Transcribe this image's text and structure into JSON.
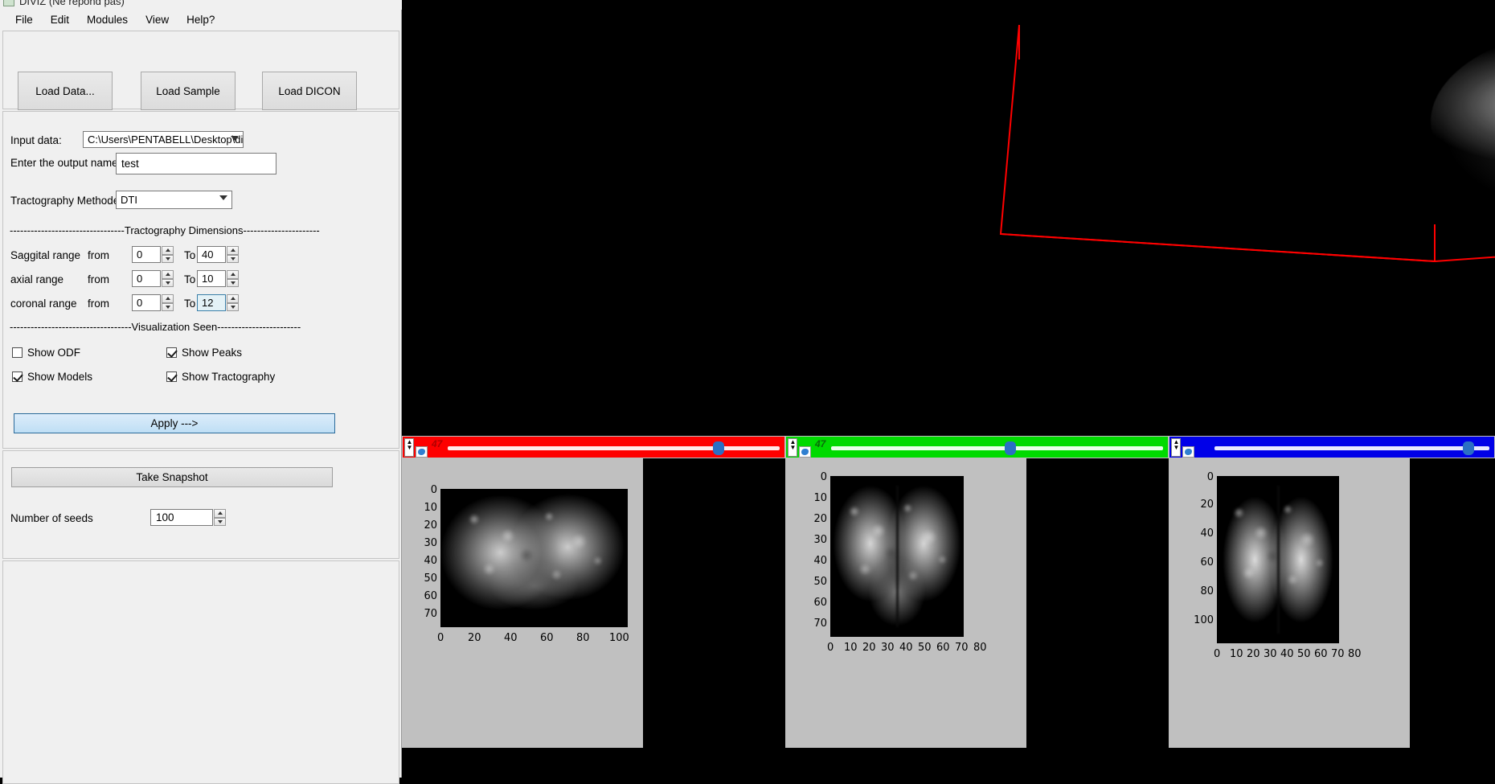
{
  "window": {
    "title": "DIVIZ (Ne repond pas)",
    "app_icon": "app-icon"
  },
  "menu": {
    "items": [
      "File",
      "Edit",
      "Modules",
      "View",
      "Help?"
    ]
  },
  "toolbar": {
    "load_data_label": "Load Data...",
    "load_sample_data_label": "Load Sample Data...",
    "load_dicom_data_label": "Load DICON Data..."
  },
  "form": {
    "input_data_label": "Input data:",
    "input_data_value": "C:\\Users\\PENTABELL\\Desktop\\dipy_",
    "output_name_label": "Enter the output name",
    "output_name_value": "test",
    "output_name_placeholder": "",
    "tractography_method_label": "Tractography Methode:",
    "tractography_method_value": "DTI"
  },
  "dimensions": {
    "section_title": "Tractography Dimensions",
    "from_label": "from",
    "to_label": "To",
    "rows": [
      {
        "label": "Saggital range",
        "from": "0",
        "to": "40",
        "focused": false
      },
      {
        "label": "axial range",
        "from": "0",
        "to": "10",
        "focused": false
      },
      {
        "label": "coronal range",
        "from": "0",
        "to": "12",
        "focused": true
      }
    ]
  },
  "visualization": {
    "section_title": "Visualization Seen",
    "checkboxes": [
      {
        "label": "Show ODF",
        "checked": false
      },
      {
        "label": "Show Peaks",
        "checked": true
      },
      {
        "label": "Show Models",
        "checked": true
      },
      {
        "label": "Show Tractography",
        "checked": true
      }
    ]
  },
  "actions": {
    "apply_label": "Apply --->",
    "snapshot_label": "Take Snapshot",
    "seeds_label": "Number of seeds",
    "seeds_value": "100"
  },
  "colors": {
    "panel_bg": "#f0f0f0",
    "apply_accent": "#bfdff5",
    "slider_red": "#fe0000",
    "slider_green": "#00da00",
    "slider_blue": "#0000e8",
    "knob": "#2b6fc4",
    "wireframe": "#ff0000",
    "plot_bg": "#c0c0c0"
  },
  "viewport3d": {
    "name": "3D tractography render",
    "wireframe_color": "#ff0000",
    "background": "#000000"
  },
  "slice_panels": [
    {
      "name": "sagittal",
      "slider_color": "#fe0000",
      "slider_value": "47",
      "slider_fraction": 0.79,
      "x_ticks": [
        "0",
        "20",
        "40",
        "60",
        "80",
        "100"
      ],
      "y_ticks": [
        "0",
        "10",
        "20",
        "30",
        "40",
        "50",
        "60",
        "70"
      ]
    },
    {
      "name": "coronal",
      "slider_color": "#00da00",
      "slider_value": "47",
      "slider_fraction": 0.57,
      "x_ticks": [
        "0",
        "10",
        "20",
        "30",
        "40",
        "50",
        "60",
        "70",
        "80"
      ],
      "y_ticks": [
        "0",
        "10",
        "20",
        "30",
        "40",
        "50",
        "60",
        "70"
      ]
    },
    {
      "name": "axial",
      "slider_color": "#0000e8",
      "slider_value": "",
      "slider_fraction": 0.9,
      "x_ticks": [
        "0",
        "10",
        "20",
        "30",
        "40",
        "50",
        "60",
        "70",
        "80"
      ],
      "y_ticks": [
        "0",
        "20",
        "40",
        "60",
        "80",
        "100"
      ]
    }
  ]
}
